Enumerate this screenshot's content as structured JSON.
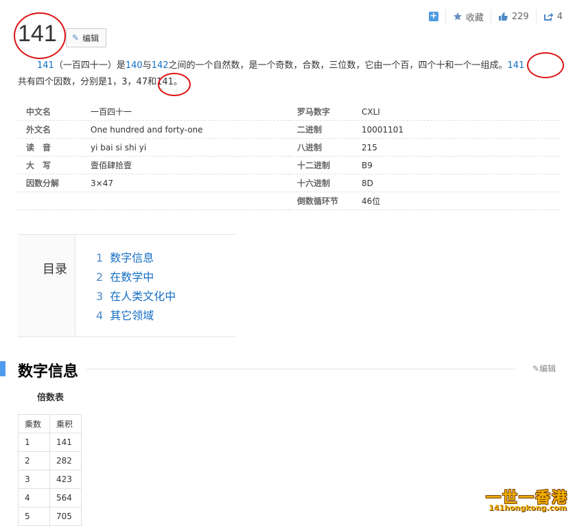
{
  "toolbar": {
    "collect_label": "收藏",
    "like_count": "229",
    "share_count": "4"
  },
  "title": "141",
  "edit_label": "编辑",
  "summary": {
    "link1": "141",
    "t1": "（一百四十一）是",
    "link2": "140",
    "t2": "与",
    "link3": "142",
    "t3": "之间的一个自然数，是一个奇数，合数，三位数，它由一个百，四个十和一个一组成。",
    "link4": "141",
    "t4": "共有四个因数，分别是1，3，47和141。"
  },
  "basic_info": {
    "left": [
      {
        "key": "中文名",
        "value": "一百四十一"
      },
      {
        "key": "外文名",
        "value": "One hundred and forty-one"
      },
      {
        "key": "读　音",
        "value": "yi bai si shi yi"
      },
      {
        "key": "大　写",
        "value": "壹佰肆拾壹"
      },
      {
        "key": "因数分解",
        "value": "3×47"
      }
    ],
    "right": [
      {
        "key": "罗马数字",
        "value": "CXLI"
      },
      {
        "key": "二进制",
        "value": "10001101"
      },
      {
        "key": "八进制",
        "value": "215"
      },
      {
        "key": "十二进制",
        "value": "B9"
      },
      {
        "key": "十六进制",
        "value": "8D"
      },
      {
        "key": "倒数循环节",
        "value": "46位"
      }
    ]
  },
  "toc": {
    "label": "目录",
    "items": [
      {
        "num": "1",
        "label": "数字信息"
      },
      {
        "num": "2",
        "label": "在数学中"
      },
      {
        "num": "3",
        "label": "在人类文化中"
      },
      {
        "num": "4",
        "label": "其它领域"
      }
    ]
  },
  "section": {
    "title": "数字信息",
    "edit_label": "编辑",
    "table_caption": "倍数表",
    "headers": [
      "乘数",
      "乘积"
    ],
    "rows": [
      [
        "1",
        "141"
      ],
      [
        "2",
        "282"
      ],
      [
        "3",
        "423"
      ],
      [
        "4",
        "564"
      ],
      [
        "5",
        "705"
      ]
    ]
  },
  "watermark": {
    "main": "一世一香港",
    "sub": "141hongkong.com"
  },
  "colors": {
    "link": "#136ec2",
    "accent": "#4f9cee",
    "annotation": "#dd1111"
  }
}
